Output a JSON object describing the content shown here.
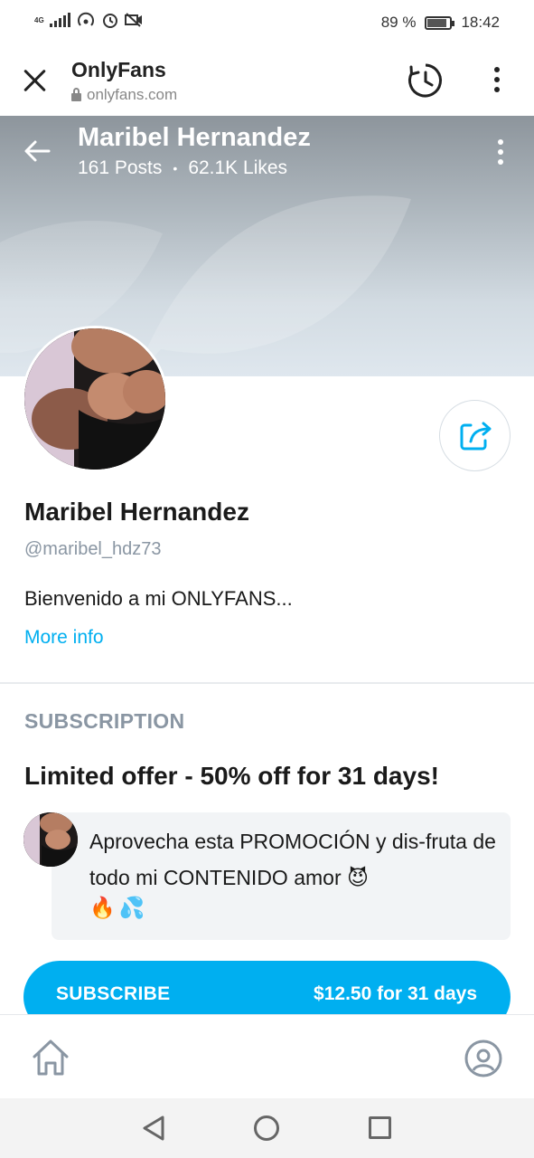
{
  "status_bar": {
    "network": "4G",
    "battery_percent": "89 %",
    "battery_level": 0.89,
    "time": "18:42"
  },
  "browser": {
    "site_title": "OnlyFans",
    "site_url": "onlyfans.com",
    "icons": [
      "close-icon",
      "lock-icon",
      "history-icon",
      "more-vertical-icon"
    ]
  },
  "header": {
    "name": "Maribel Hernandez",
    "posts": "161 Posts",
    "separator": "•",
    "likes": "62.1K Likes"
  },
  "profile": {
    "name": "Maribel Hernandez",
    "handle": "@maribel_hdz73",
    "bio": "Bienvenido a mi ONLYFANS...",
    "more_info": "More info"
  },
  "subscription": {
    "heading": "SUBSCRIPTION",
    "offer": "Limited offer - 50% off for 31 days!",
    "message": "Aprovecha esta PROMOCIÓN y dis-fruta de todo mi CONTENIDO amor",
    "emojis": [
      "😈",
      "🔥",
      "💦"
    ],
    "subscribe_label": "SUBSCRIBE",
    "subscribe_price": "$12.50 for 31 days"
  },
  "colors": {
    "accent": "#00aff0",
    "muted": "#8a96a3"
  }
}
